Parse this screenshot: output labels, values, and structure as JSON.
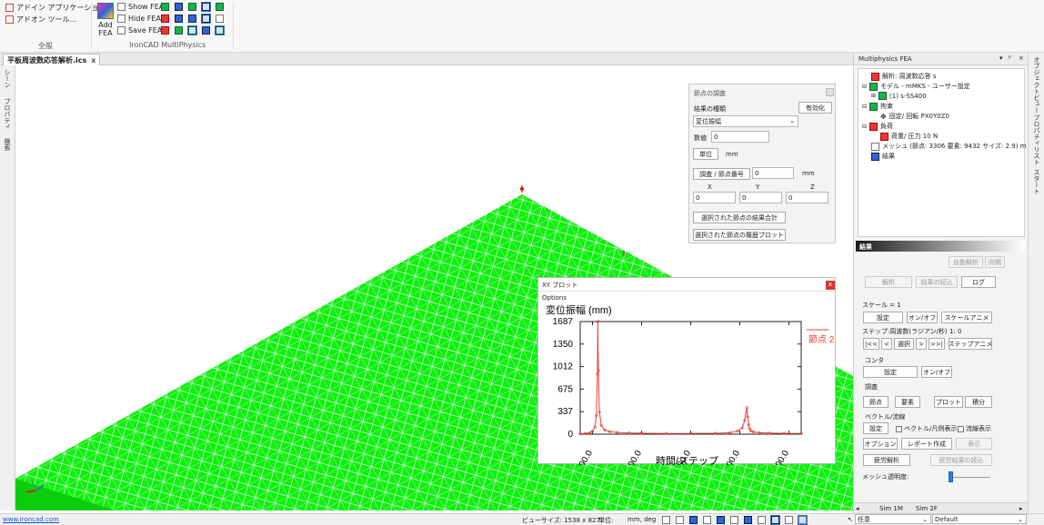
{
  "ribbon": {
    "addin_app": "アドイン アプリケーション...",
    "addin_tool": "アドオン ツール...",
    "general_group": "全般",
    "add_fea_line1": "Add",
    "add_fea_line2": "FEA",
    "show_fea": "Show FEA",
    "hide_fea": "Hide FEA",
    "save_fea": "Save FEA",
    "multiphysics_group": "IronCAD MultiPhysics"
  },
  "document_tab": {
    "title": "平板周波数応答解析.ics",
    "close": "x"
  },
  "left_strip": {
    "scene": "シーン",
    "property": "プロパティ",
    "search": "検索"
  },
  "right_strip": {
    "object": "オブジェクトビュー",
    "proplist": "プロパティリスト",
    "start": "スタート"
  },
  "node_probe": {
    "title": "節点の調査",
    "result_type_label": "結果の種類",
    "enable_button": "有効化",
    "result_type_value": "変位振幅",
    "value_label": "数値",
    "value": "0",
    "unit_button": "単位",
    "unit_value": "mm",
    "probe_button": "調査 / 節点番号",
    "node_number": "0",
    "node_unit": "mm",
    "x_label": "X",
    "y_label": "Y",
    "z_label": "Z",
    "x_value": "0",
    "y_value": "0",
    "z_value": "0",
    "sum_button": "選択された節点の結果合計",
    "history_button": "選択された節点の履歴プロット"
  },
  "xy_plot": {
    "title": "XY プロット",
    "close": "x",
    "options": "Options",
    "chart_data": {
      "type": "line",
      "title": "",
      "ylabel": "変位振幅 (mm)",
      "xlabel": "時間/ステップ",
      "ylim": [
        0,
        1687
      ],
      "xlim": [
        75,
        525
      ],
      "y_ticks": [
        "0",
        "337",
        "675",
        "1012",
        "1350",
        "1687"
      ],
      "x_ticks": [
        "100.0",
        "200.0",
        "300.0",
        "400.0",
        "500.0"
      ],
      "legend": "top-right",
      "series": [
        {
          "name": "節点 2",
          "color": "#e8403a",
          "x": [
            75,
            85,
            95,
            100,
            105,
            108,
            110,
            111,
            112,
            114,
            118,
            125,
            135,
            150,
            175,
            200,
            250,
            300,
            350,
            380,
            395,
            405,
            410,
            414,
            416,
            418,
            420,
            423,
            428,
            440,
            460,
            490,
            525
          ],
          "y": [
            3,
            8,
            22,
            45,
            110,
            280,
            900,
            1687,
            950,
            330,
            130,
            62,
            38,
            26,
            18,
            14,
            11,
            11,
            14,
            22,
            45,
            95,
            210,
            400,
            260,
            140,
            80,
            48,
            32,
            22,
            16,
            12,
            10
          ]
        }
      ]
    }
  },
  "fea_panel": {
    "title": "Multiphysics FEA",
    "tree": {
      "analysis": "解析: 周波数応答 s",
      "model": "モデル - mMKS - ユーザー設定",
      "material": "(1) s-SS400",
      "constraint": "拘束",
      "fixed": "固定/ 回転 PX0Y0Z0",
      "load": "負荷",
      "pressure": "荷重/ 圧力 10 N",
      "mesh": "メッシュ (節点: 3306  要素: 9432  サイズ: 2.9) m",
      "result": "結果"
    }
  },
  "results_panel": {
    "header": "結果",
    "auto_analysis": "自動解析",
    "sync": "同期",
    "analysis_button": "解析",
    "load_results": "結果の読込",
    "log_button": "ログ",
    "scale_label": "スケール = 1",
    "scale_settings": "設定",
    "scale_onoff": "オン/オフ",
    "scale_anim": "スケールアニメ",
    "step_label": "ステップ:周波数(ラジアン/秒) 1: 0",
    "step_first": "|<<",
    "step_prev": "<",
    "step_select": "選択",
    "step_next": ">",
    "step_last": ">>|",
    "step_anim": "ステップアニメ",
    "contour_label": "コンタ",
    "contour_settings": "設定",
    "contour_onoff": "オン/オフ",
    "probe_label": "調査",
    "probe_node": "節点",
    "probe_element": "要素",
    "probe_plot": "プロット",
    "probe_integral": "積分",
    "vector_label": "ベクトル/流線",
    "vector_settings": "設定",
    "vector_legend": "ベクトル/凡例表示",
    "streamline": "流線表示",
    "options_button": "オプション",
    "report_button": "レポート作成",
    "display_button": "表示",
    "fatigue_button": "疲労解析",
    "fatigue_load": "疲労結果の読込",
    "mesh_transparency": "メッシュ透明度:",
    "mesh_transparency_value": 0.0
  },
  "bottom_tabs": {
    "sim1": "Sim 1M",
    "sim2": "Sim 2F"
  },
  "status": {
    "link": "www.ironcad.com",
    "view_size": "ビューサイズ: 1538 x  827",
    "units": "単位:",
    "units_value": "mm, deg",
    "mode": "任意",
    "scheme": "Default"
  }
}
